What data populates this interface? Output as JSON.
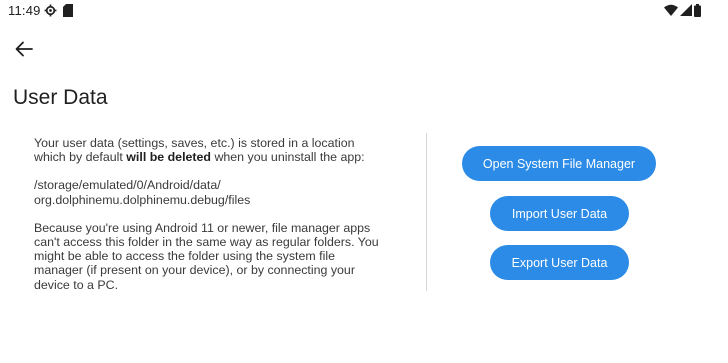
{
  "status_bar": {
    "time": "11:49",
    "icons": [
      "settings-gear-icon",
      "sd-card-icon",
      "wifi-icon",
      "signal-icon",
      "battery-icon"
    ]
  },
  "toolbar": {
    "back_icon": "arrow-back-icon"
  },
  "page": {
    "title": "User Data"
  },
  "body_text": {
    "intro_before": "Your user data (settings, saves, etc.) is stored in a location which by default ",
    "intro_bold": "will be deleted",
    "intro_after": " when you uninstall the app:",
    "path_line1": "/storage/emulated/0/Android/data/",
    "path_line2": "org.dolphinemu.dolphinemu.debug/files",
    "android11_note": "Because you're using Android 11 or newer, file manager apps can't access this folder in the same way as regular folders. You might be able to access the folder using the system file manager (if present on your device), or by connecting your device to a PC."
  },
  "actions": {
    "open_file_manager": "Open System File Manager",
    "import_user_data": "Import User Data",
    "export_user_data": "Export User Data"
  },
  "colors": {
    "accent": "#2b8be6",
    "background": "#ffffff",
    "divider": "#d6d6d6"
  }
}
